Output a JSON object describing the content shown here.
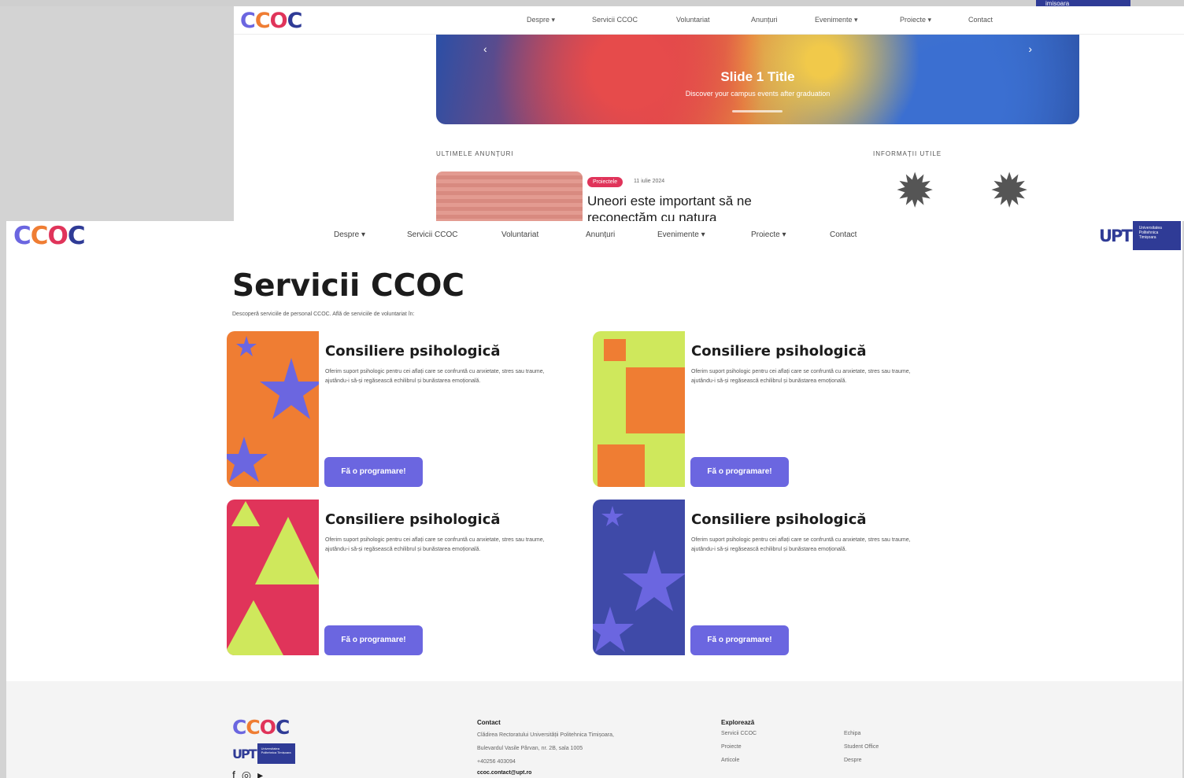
{
  "logo": {
    "text": [
      "C",
      "C",
      "O",
      "C"
    ],
    "colors": [
      "#6b66e0",
      "#ef7d33",
      "#e0345a",
      "#2f3b96"
    ]
  },
  "background_window": {
    "nav": [
      "Despre ▾",
      "Servicii CCOC",
      "Voluntariat",
      "Anunțuri",
      "Evenimente ▾",
      "Proiecte ▾",
      "Contact"
    ],
    "hero": {
      "title": "Slide 1 Title",
      "subtitle": "Discover your campus events after graduation"
    },
    "section_left": "ULTIMELE ANUNȚURI",
    "section_right": "INFORMAȚII UTILE",
    "news": {
      "badge": "Proiectele",
      "date": "11 iulie 2024",
      "title": "Uneori este important să ne reconectăm cu natura"
    },
    "upt_strip": "imisoara"
  },
  "nav": [
    "Despre ▾",
    "Servicii CCOC",
    "Voluntariat",
    "Anunțuri",
    "Evenimente ▾",
    "Proiecte ▾",
    "Contact"
  ],
  "upt": {
    "letters": "UPT",
    "text": "Universitatea Politehnica Timișoara"
  },
  "page": {
    "title": "Servicii CCOC",
    "subtitle": "Descoperă serviciile de personal CCOC. Află de serviciile de voluntariat în:"
  },
  "cards": [
    {
      "title": "Consiliere psihologică",
      "description": "Oferim suport psihologic pentru cei aflați care se confruntă cu anxietate, stres sau traume, ajutându-i să-și regăsească echilibrul și bunăstarea emoțională.",
      "button": "Fă o programare!",
      "art": "orange-stars"
    },
    {
      "title": "Consiliere psihologică",
      "description": "Oferim suport psihologic pentru cei aflați care se confruntă cu anxietate, stres sau traume, ajutându-i să-și regăsească echilibrul și bunăstarea emoțională.",
      "button": "Fă o programare!",
      "art": "lime-squares"
    },
    {
      "title": "Consiliere psihologică",
      "description": "Oferim suport psihologic pentru cei aflați care se confruntă cu anxietate, stres sau traume, ajutându-i să-și regăsească echilibrul și bunăstarea emoțională.",
      "button": "Fă o programare!",
      "art": "red-triangles"
    },
    {
      "title": "Consiliere psihologică",
      "description": "Oferim suport psihologic pentru cei aflați care se confruntă cu anxietate, stres sau traume, ajutându-i să-și regăsească echilibrul și bunăstarea emoțională.",
      "button": "Fă o programare!",
      "art": "indigo-stars"
    }
  ],
  "footer": {
    "contact": {
      "heading": "Contact",
      "lines": [
        "Clădirea Rectoratului Universității Politehnica Timișoara,",
        "Bulevardul Vasile Pârvan, nr. 2B, sala 1005",
        "+40256 403094",
        "ccoc.contact@upt.ro"
      ]
    },
    "explore": {
      "heading": "Explorează",
      "col1": [
        "Servicii CCOC",
        "Proiecte",
        "Articole"
      ],
      "col2": [
        "Echipa",
        "Student Office",
        "Despre"
      ]
    }
  }
}
